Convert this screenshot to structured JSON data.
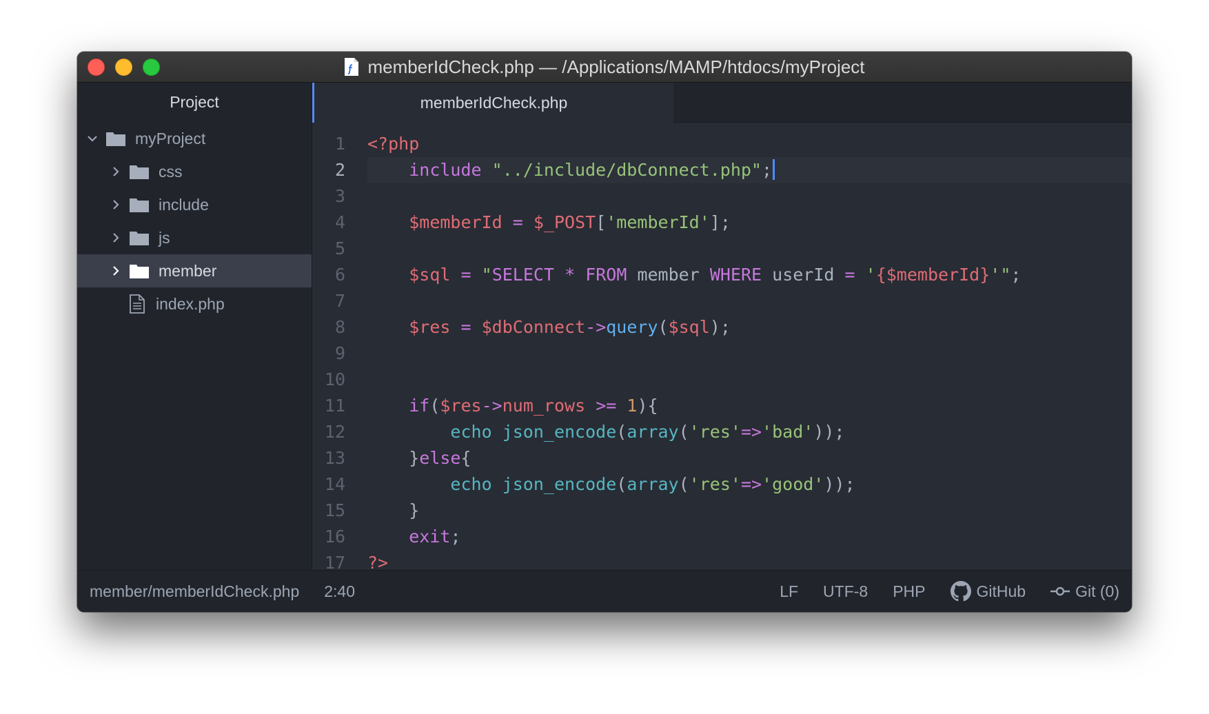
{
  "window": {
    "title": "memberIdCheck.php — /Applications/MAMP/htdocs/myProject",
    "title_icon": "php-file-icon"
  },
  "sidebar": {
    "header": "Project",
    "root": {
      "label": "myProject",
      "expanded": true
    },
    "items": [
      {
        "label": "css",
        "type": "folder"
      },
      {
        "label": "include",
        "type": "folder"
      },
      {
        "label": "js",
        "type": "folder"
      },
      {
        "label": "member",
        "type": "folder",
        "selected": true
      },
      {
        "label": "index.php",
        "type": "file"
      }
    ]
  },
  "tabs": [
    {
      "label": "memberIdCheck.php",
      "active": true
    }
  ],
  "editor": {
    "current_line": 2,
    "lines": [
      {
        "n": "1",
        "tokens": [
          [
            "tag",
            "<?php"
          ]
        ]
      },
      {
        "n": "2",
        "tokens": [
          [
            "plain",
            "    "
          ],
          [
            "kw",
            "include"
          ],
          [
            "plain",
            " "
          ],
          [
            "str",
            "\"../include/dbConnect.php\""
          ],
          [
            "pun",
            ";"
          ]
        ]
      },
      {
        "n": "3",
        "tokens": []
      },
      {
        "n": "4",
        "tokens": [
          [
            "plain",
            "    "
          ],
          [
            "var",
            "$memberId"
          ],
          [
            "pun",
            " "
          ],
          [
            "op",
            "="
          ],
          [
            "pun",
            " "
          ],
          [
            "var",
            "$_POST"
          ],
          [
            "pun",
            "["
          ],
          [
            "str",
            "'memberId'"
          ],
          [
            "pun",
            "];"
          ]
        ]
      },
      {
        "n": "5",
        "tokens": []
      },
      {
        "n": "6",
        "tokens": [
          [
            "plain",
            "    "
          ],
          [
            "var",
            "$sql"
          ],
          [
            "pun",
            " "
          ],
          [
            "op",
            "="
          ],
          [
            "pun",
            " "
          ],
          [
            "str",
            "\""
          ],
          [
            "kw",
            "SELECT"
          ],
          [
            "pun",
            " "
          ],
          [
            "op",
            "*"
          ],
          [
            "pun",
            " "
          ],
          [
            "kw",
            "FROM"
          ],
          [
            "plain",
            " member "
          ],
          [
            "kw",
            "WHERE"
          ],
          [
            "plain",
            " userId "
          ],
          [
            "op",
            "="
          ],
          [
            "pun",
            " "
          ],
          [
            "str",
            "'"
          ],
          [
            "var",
            "{$memberId}"
          ],
          [
            "str",
            "'\""
          ],
          [
            "pun",
            ";"
          ]
        ]
      },
      {
        "n": "7",
        "tokens": []
      },
      {
        "n": "8",
        "tokens": [
          [
            "plain",
            "    "
          ],
          [
            "var",
            "$res"
          ],
          [
            "pun",
            " "
          ],
          [
            "op",
            "="
          ],
          [
            "pun",
            " "
          ],
          [
            "var",
            "$dbConnect"
          ],
          [
            "op",
            "->"
          ],
          [
            "fn",
            "query"
          ],
          [
            "pun",
            "("
          ],
          [
            "var",
            "$sql"
          ],
          [
            "pun",
            ");"
          ]
        ]
      },
      {
        "n": "9",
        "tokens": []
      },
      {
        "n": "10",
        "tokens": []
      },
      {
        "n": "11",
        "tokens": [
          [
            "plain",
            "    "
          ],
          [
            "kw",
            "if"
          ],
          [
            "pun",
            "("
          ],
          [
            "var",
            "$res"
          ],
          [
            "op",
            "->"
          ],
          [
            "var",
            "num_rows"
          ],
          [
            "pun",
            " "
          ],
          [
            "op",
            ">="
          ],
          [
            "pun",
            " "
          ],
          [
            "num",
            "1"
          ],
          [
            "pun",
            "){"
          ]
        ]
      },
      {
        "n": "12",
        "tokens": [
          [
            "plain",
            "        "
          ],
          [
            "sup",
            "echo"
          ],
          [
            "pun",
            " "
          ],
          [
            "sup",
            "json_encode"
          ],
          [
            "pun",
            "("
          ],
          [
            "sup",
            "array"
          ],
          [
            "pun",
            "("
          ],
          [
            "str",
            "'res'"
          ],
          [
            "op",
            "=>"
          ],
          [
            "str",
            "'bad'"
          ],
          [
            "pun",
            "));"
          ]
        ]
      },
      {
        "n": "13",
        "tokens": [
          [
            "plain",
            "    "
          ],
          [
            "pun",
            "}"
          ],
          [
            "kw",
            "else"
          ],
          [
            "pun",
            "{"
          ]
        ]
      },
      {
        "n": "14",
        "tokens": [
          [
            "plain",
            "        "
          ],
          [
            "sup",
            "echo"
          ],
          [
            "pun",
            " "
          ],
          [
            "sup",
            "json_encode"
          ],
          [
            "pun",
            "("
          ],
          [
            "sup",
            "array"
          ],
          [
            "pun",
            "("
          ],
          [
            "str",
            "'res'"
          ],
          [
            "op",
            "=>"
          ],
          [
            "str",
            "'good'"
          ],
          [
            "pun",
            "));"
          ]
        ]
      },
      {
        "n": "15",
        "tokens": [
          [
            "plain",
            "    "
          ],
          [
            "pun",
            "}"
          ]
        ]
      },
      {
        "n": "16",
        "tokens": [
          [
            "plain",
            "    "
          ],
          [
            "kw",
            "exit"
          ],
          [
            "pun",
            ";"
          ]
        ]
      },
      {
        "n": "17",
        "tokens": [
          [
            "tag",
            "?>"
          ]
        ]
      }
    ]
  },
  "statusbar": {
    "file_path": "member/memberIdCheck.php",
    "cursor_position": "2:40",
    "line_ending": "LF",
    "encoding": "UTF-8",
    "grammar": "PHP",
    "github_label": "GitHub",
    "git_label": "Git (0)"
  },
  "colors": {
    "accent": "#568af2",
    "background": "#282c34",
    "panel": "#21252b"
  }
}
